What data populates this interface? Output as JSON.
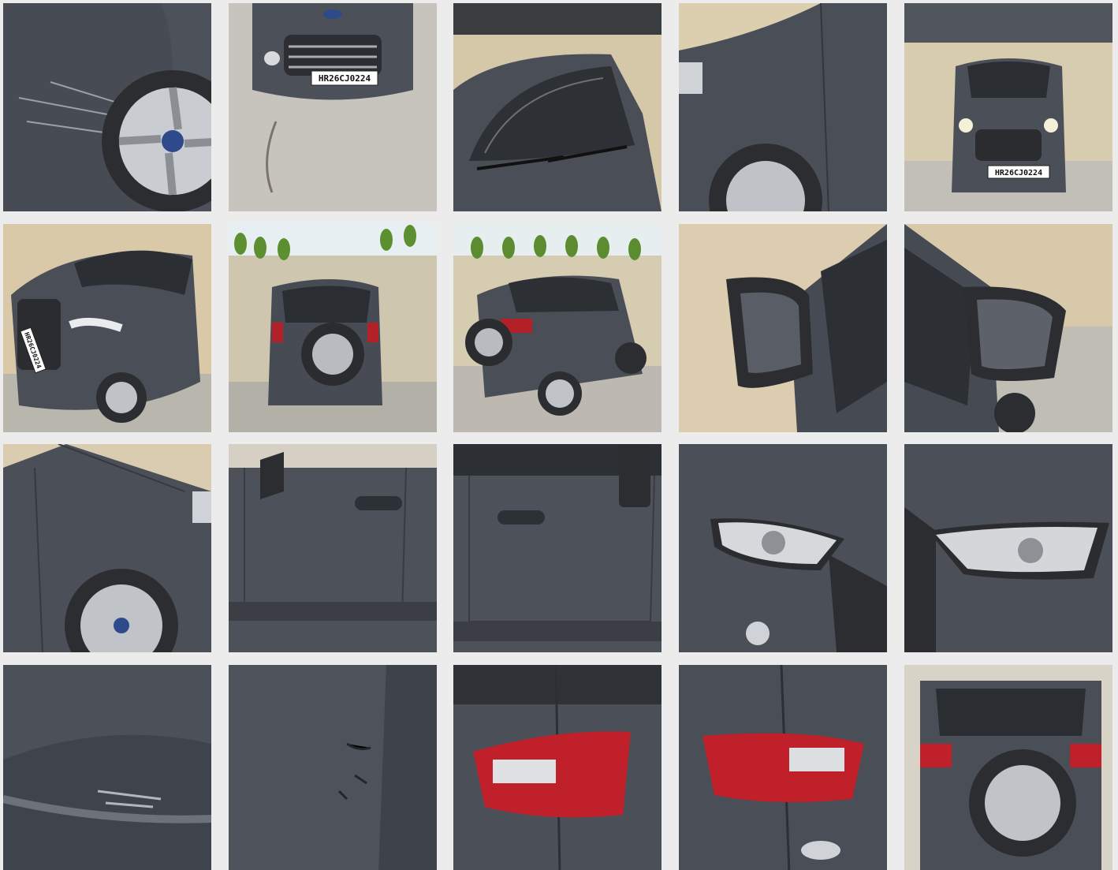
{
  "gallery": {
    "photos": [
      {
        "subject": "front-left-wheel-scratch"
      },
      {
        "subject": "front-grille-with-plate",
        "plate": "HR26CJ0224"
      },
      {
        "subject": "windshield-from-above"
      },
      {
        "subject": "right-front-fender"
      },
      {
        "subject": "front-view-headlights-on",
        "plate": "HR26CJ0224"
      },
      {
        "subject": "front-three-quarter-left",
        "plate": "HR26CJ0224"
      },
      {
        "subject": "rear-view-spare-wheel"
      },
      {
        "subject": "rear-three-quarter-left"
      },
      {
        "subject": "left-side-mirror"
      },
      {
        "subject": "right-side-mirror"
      },
      {
        "subject": "left-front-fender-wheel"
      },
      {
        "subject": "front-door-left"
      },
      {
        "subject": "rear-door-left"
      },
      {
        "subject": "left-headlight"
      },
      {
        "subject": "right-headlight"
      },
      {
        "subject": "bumper-scuff-closeup"
      },
      {
        "subject": "panel-marks-closeup"
      },
      {
        "subject": "left-tail-light"
      },
      {
        "subject": "right-tail-light"
      },
      {
        "subject": "rear-spare-wheel-closeup"
      }
    ]
  },
  "colors": {
    "page_background": "#ececec",
    "body_paint": "#4a4e57",
    "wall": "#d9c9a8",
    "ground": "#bdbab2",
    "tail_light": "#c0202a"
  }
}
